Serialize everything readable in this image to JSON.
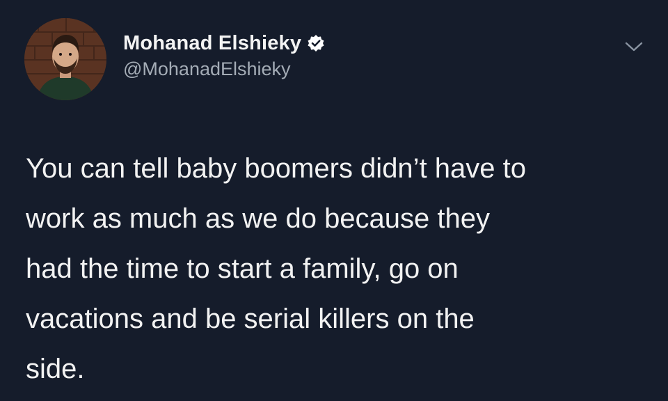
{
  "user": {
    "display_name": "Mohanad Elshieky",
    "handle": "@MohanadElshieky",
    "verified": true,
    "avatar_icon": "profile-photo"
  },
  "tweet": {
    "text": "You can tell baby boomers didn’t have to\nwork as much as we do because they\nhad the time to start a family, go on\nvacations and be serial killers on the\nside."
  },
  "menu_icon": "chevron-down-icon",
  "colors": {
    "background": "#151c2b",
    "text": "#f2f2f2",
    "handle": "#a4acb6",
    "verified_badge": "#ffffff"
  }
}
